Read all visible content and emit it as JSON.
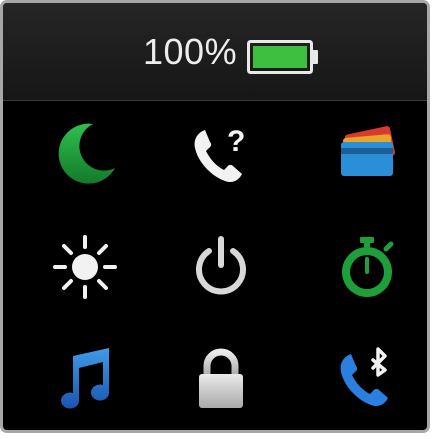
{
  "status_bar": {
    "battery_percent_text": "100%",
    "battery_level": 1.0,
    "battery_icon": "battery-full-icon",
    "battery_color": "#3fbf3f"
  },
  "quick_settings": [
    {
      "name": "do-not-disturb-icon",
      "icon": "moon",
      "color": "#1e9e3a"
    },
    {
      "name": "find-my-phone-icon",
      "icon": "phone-question",
      "color": "#f2f2f2"
    },
    {
      "name": "wallet-icon",
      "icon": "cards",
      "color": "#2a8fd8"
    },
    {
      "name": "brightness-icon",
      "icon": "sun",
      "color": "#f2f2f2"
    },
    {
      "name": "power-icon",
      "icon": "power",
      "color": "#d8d8d8"
    },
    {
      "name": "stopwatch-icon",
      "icon": "stopwatch",
      "color": "#1f9f3a"
    },
    {
      "name": "music-controls-icon",
      "icon": "music-note",
      "color": "#2a75d8"
    },
    {
      "name": "lock-icon",
      "icon": "padlock",
      "color": "#d6d6d6"
    },
    {
      "name": "bluetooth-phone-icon",
      "icon": "phone-bluetooth",
      "color": "#2a7fe0"
    }
  ]
}
